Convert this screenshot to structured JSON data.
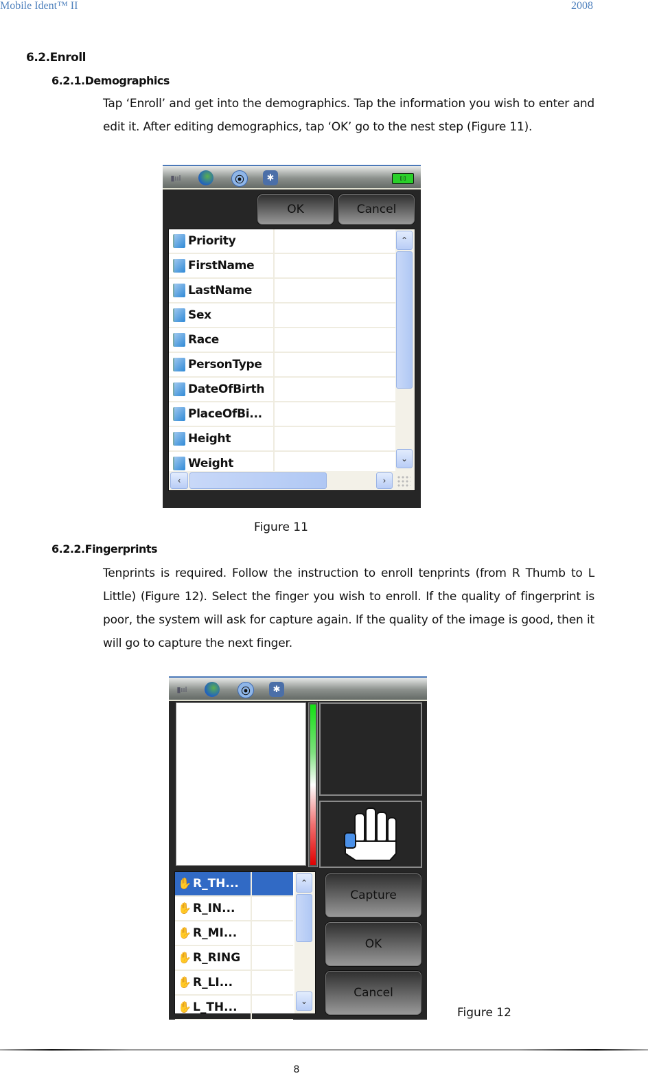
{
  "header": {
    "left": "Mobile Ident™ II",
    "right": "2008"
  },
  "section": {
    "heading": "6.2.Enroll",
    "demographics": {
      "heading": "6.2.1.Demographics",
      "paragraph": "Tap ‘Enroll’ and get into the demographics. Tap the information you wish to enter and edit it. After editing demographics, tap ‘OK’ go to the nest step (Figure 11).",
      "caption": "Figure 11"
    },
    "fingerprints": {
      "heading": "6.2.2.Fingerprints",
      "paragraph": "Tenprints is required. Follow the instruction to enroll tenprints (from R Thumb to L Little) (Figure 12). Select the finger you wish to enroll. If the quality of fingerprint is poor, the system will ask for capture again. If the quality of the image is good, then it will go to capture the next finger.",
      "caption": "Figure 12"
    }
  },
  "status_icons": {
    "signal": "signal-icon",
    "network": "globe-icon",
    "radio": "radio-icon",
    "bluetooth": "bluetooth-icon",
    "battery": "battery-icon",
    "radio_glyph": "⦿",
    "bluetooth_glyph": "✱",
    "signal_glyph": "▮ııl",
    "battery_glyph": "▯▯"
  },
  "figure11": {
    "ok_label": "OK",
    "cancel_label": "Cancel",
    "fields": [
      {
        "name": "Priority",
        "value": ""
      },
      {
        "name": "FirstName",
        "value": ""
      },
      {
        "name": "LastName",
        "value": ""
      },
      {
        "name": "Sex",
        "value": ""
      },
      {
        "name": "Race",
        "value": ""
      },
      {
        "name": "PersonType",
        "value": ""
      },
      {
        "name": "DateOfBirth",
        "value": ""
      },
      {
        "name": "PlaceOfBi...",
        "value": ""
      },
      {
        "name": "Height",
        "value": ""
      },
      {
        "name": "Weight",
        "value": ""
      }
    ],
    "scroll_up": "⌃",
    "scroll_down": "⌄",
    "scroll_left": "‹",
    "scroll_right": "›"
  },
  "figure12": {
    "capture_label": "Capture",
    "ok_label": "OK",
    "cancel_label": "Cancel",
    "quality_level": 1.0,
    "selected_finger": "R_TH...",
    "fingers": [
      {
        "name": "R_TH...",
        "selected": true
      },
      {
        "name": "R_IN...",
        "selected": false
      },
      {
        "name": "R_MI...",
        "selected": false
      },
      {
        "name": "R_RING",
        "selected": false
      },
      {
        "name": "R_LI...",
        "selected": false
      },
      {
        "name": "L_TH...",
        "selected": false
      }
    ],
    "hand_glyph": "✋",
    "scroll_up": "⌃",
    "scroll_down": "⌄"
  },
  "footer": {
    "page_number": "8"
  },
  "colors": {
    "header_blue": "#4f81bd",
    "selection_blue": "#316ac5",
    "quality_green": "#12e012",
    "quality_red": "#e00000"
  }
}
